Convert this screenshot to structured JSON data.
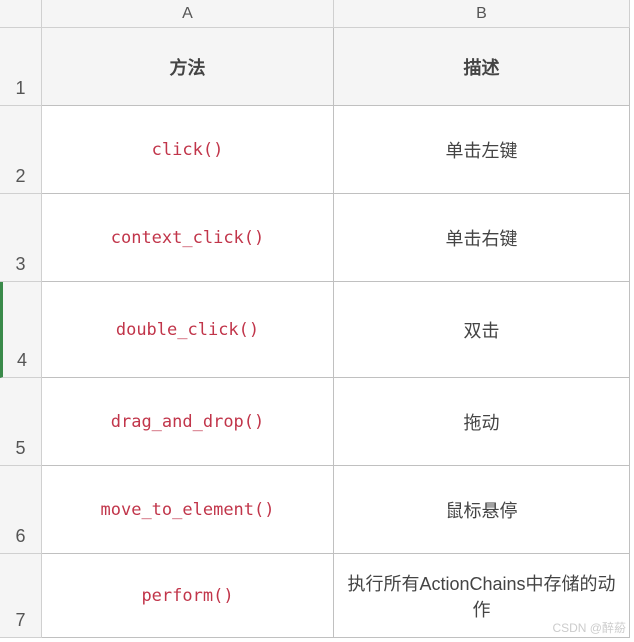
{
  "columns": [
    "A",
    "B"
  ],
  "row_numbers": [
    "1",
    "2",
    "3",
    "4",
    "5",
    "6",
    "7"
  ],
  "table_headers": {
    "method": "方法",
    "description": "描述"
  },
  "rows": [
    {
      "method": "click()",
      "description": "单击左键"
    },
    {
      "method": "context_click()",
      "description": "单击右键"
    },
    {
      "method": "double_click()",
      "description": "双击"
    },
    {
      "method": "drag_and_drop()",
      "description": "拖动"
    },
    {
      "method": "move_to_element()",
      "description": "鼠标悬停"
    },
    {
      "method": "perform()",
      "description": "执行所有ActionChains中存储的动作"
    }
  ],
  "watermark": "CSDN @醉蒶"
}
